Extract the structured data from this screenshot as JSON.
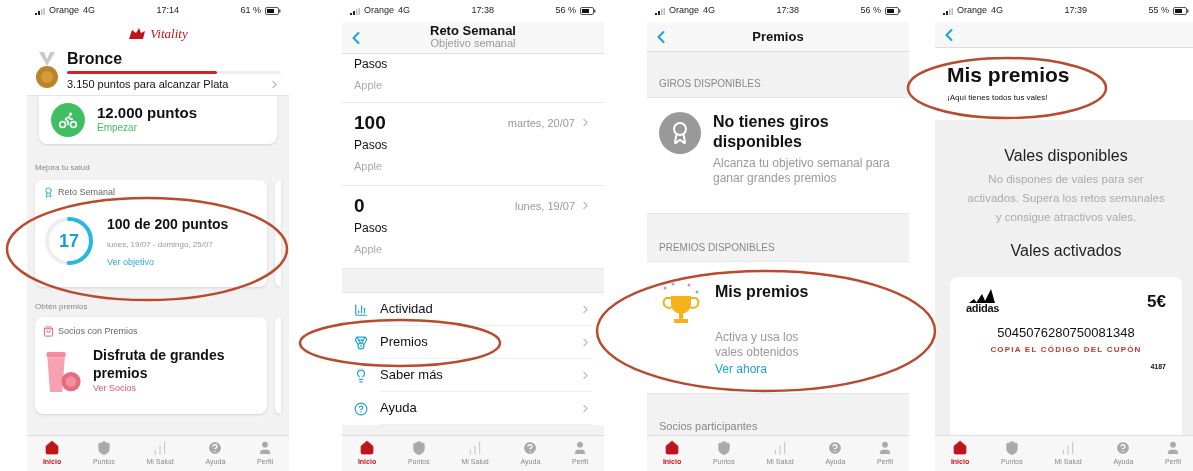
{
  "screens": [
    {
      "kind": "home",
      "status": {
        "carrier": "Orange",
        "network": "4G",
        "time": "17:14",
        "battery": "61 %"
      },
      "logo": "Vitality",
      "level_card": {
        "title": "Bronce",
        "level": 0.7,
        "caption": "3.150 puntos para alcanzar Plata"
      },
      "top_card": {
        "title": "12.000 puntos",
        "link": "Empezar"
      },
      "section_1": "Mejora tu salud",
      "challenge_card": {
        "label": "Reto Semanal",
        "ring_value": "17",
        "level": 0.5,
        "title": "100 de 200 puntos",
        "dates": "lunes, 19/07 - domingo, 25/07",
        "link": "Ver objetivo"
      },
      "section_2": "Obtén premios",
      "partner_card": {
        "label": "Socios con Premios",
        "title": "Disfruta de grandes premios",
        "link": "Ver Socios"
      },
      "tabs": [
        {
          "label": "Inicio",
          "selected": true
        },
        {
          "label": "Puntos",
          "selected": false
        },
        {
          "label": "Mi Salud",
          "selected": false
        },
        {
          "label": "Ayuda",
          "selected": false
        },
        {
          "label": "Perfil",
          "selected": false
        }
      ]
    },
    {
      "kind": "challenge",
      "status": {
        "carrier": "Orange",
        "network": "4G",
        "time": "17:38",
        "battery": "56 %"
      },
      "title": "Reto Semanal",
      "subtitle": "Objetivo semanal",
      "entries": [
        {
          "unit": "Pasos",
          "source": "Apple"
        },
        {
          "value": "100",
          "date": "martes, 20/07",
          "unit": "Pasos",
          "source": "Apple"
        },
        {
          "value": "0",
          "date": "lunes, 19/07",
          "unit": "Pasos",
          "source": "Apple"
        }
      ],
      "menu": [
        {
          "label": "Actividad"
        },
        {
          "label": "Premios"
        },
        {
          "label": "Saber más"
        },
        {
          "label": "Ayuda"
        }
      ],
      "tabs": [
        {
          "label": "Inicio",
          "selected": true
        },
        {
          "label": "Puntos",
          "selected": false
        },
        {
          "label": "Mi Salud",
          "selected": false
        },
        {
          "label": "Ayuda",
          "selected": false
        },
        {
          "label": "Perfil",
          "selected": false
        }
      ]
    },
    {
      "kind": "prizes",
      "status": {
        "carrier": "Orange",
        "network": "4G",
        "time": "17:38",
        "battery": "56 %"
      },
      "title": "Premios",
      "section_1": "GIROS DISPONIBLES",
      "spins": {
        "title": "No tienes giros disponibles",
        "text": "Alcanza tu objetivo semanal para ganar grandes premios"
      },
      "section_2": "PREMIOS DISPONIBLES",
      "my_prizes": {
        "title": "Mis premios",
        "text": "Activa y usa los vales obtenidos",
        "link": "Ver ahora"
      },
      "section_3": "Socios participantes",
      "tabs": [
        {
          "label": "Inicio",
          "selected": true
        },
        {
          "label": "Puntos",
          "selected": false
        },
        {
          "label": "Mi Salud",
          "selected": false
        },
        {
          "label": "Ayuda",
          "selected": false
        },
        {
          "label": "Perfil",
          "selected": false
        }
      ]
    },
    {
      "kind": "vouchers",
      "status": {
        "carrier": "Orange",
        "network": "4G",
        "time": "17:39",
        "battery": "55 %"
      },
      "title": "Mis premios",
      "subtitle": "¡Aquí tienes todos tus vales!",
      "available_title": "Vales disponibles",
      "available_text": "No dispones de vales para ser activados. Supera los retos semanales y consigue atractivos vales.",
      "activated_title": "Vales activados",
      "voucher": {
        "brand": "adidas",
        "amount": "5€",
        "code": "5045076280750081348",
        "action": "COPIA EL CÓDIGO DEL CUPÓN",
        "number": "4187"
      },
      "tabs": [
        {
          "label": "Inicio",
          "selected": true
        },
        {
          "label": "Puntos",
          "selected": false
        },
        {
          "label": "Mi Salud",
          "selected": false
        },
        {
          "label": "Ayuda",
          "selected": false
        },
        {
          "label": "Perfil",
          "selected": false
        }
      ]
    }
  ]
}
